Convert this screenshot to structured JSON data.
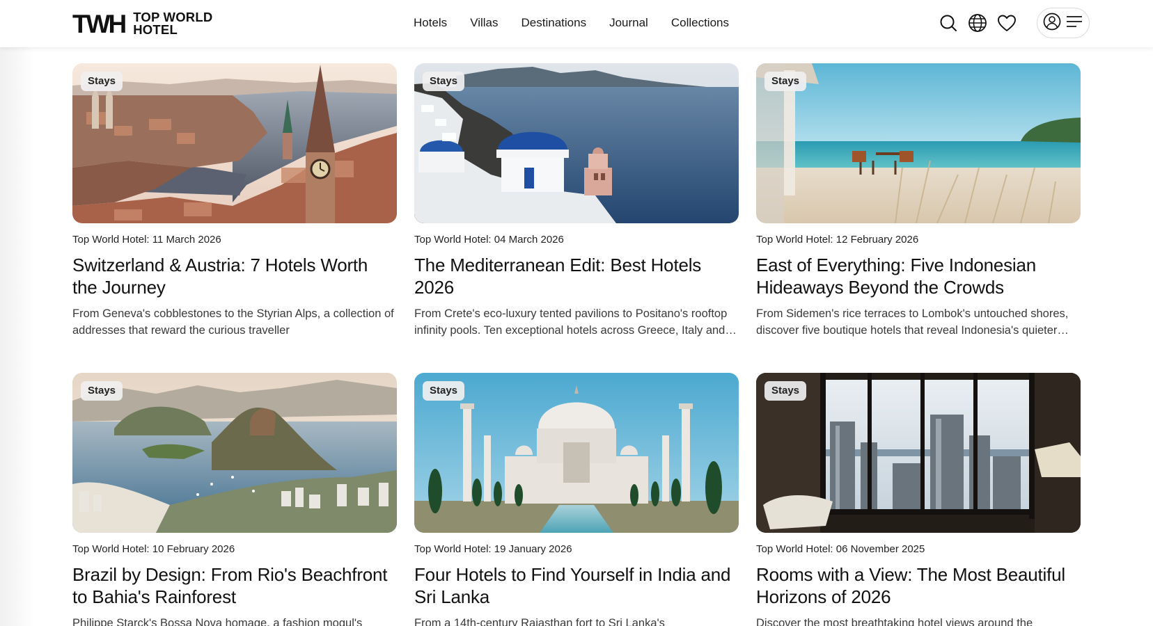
{
  "brand": {
    "mark": "TWH",
    "line1": "TOP WORLD",
    "line2": "HOTEL"
  },
  "nav": [
    "Hotels",
    "Villas",
    "Destinations",
    "Journal",
    "Collections"
  ],
  "header_icons": [
    "search-icon",
    "globe-icon",
    "heart-icon",
    "user-icon",
    "menu-icon"
  ],
  "cards": [
    {
      "tag": "Stays",
      "source": "Top World Hotel:",
      "date": "11 March 2026",
      "title": "Switzerland & Austria: 7 Hotels Worth the Journey",
      "excerpt": "From Geneva's cobblestones to the Styrian Alps, a collection of addresses that reward the curious traveller",
      "image": "zurich-old-town-clock-tower-lake"
    },
    {
      "tag": "Stays",
      "source": "Top World Hotel:",
      "date": "04 March 2026",
      "title": "The Mediterranean Edit: Best Hotels 2026",
      "excerpt": "From Crete's eco-luxury tented pavilions to Positano's rooftop infinity pools. Ten exceptional hotels across Greece, Italy and beyond",
      "image": "santorini-blue-domes-sea"
    },
    {
      "tag": "Stays",
      "source": "Top World Hotel:",
      "date": "12 February 2026",
      "title": "East of Everything: Five Indonesian Hideaways Beyond the Crowds",
      "excerpt": "From Sidemen's rice terraces to Lombok's untouched shores, discover five boutique hotels that reveal Indonesia's quieter side",
      "image": "beach-table-chairs-turquoise-sea"
    },
    {
      "tag": "Stays",
      "source": "Top World Hotel:",
      "date": "10 February 2026",
      "title": "Brazil by Design: From Rio's Beachfront to Bahia's Rainforest",
      "excerpt": "Philippe Starck's Bossa Nova homage, a fashion mogul's",
      "image": "rio-sugarloaf-bay"
    },
    {
      "tag": "Stays",
      "source": "Top World Hotel:",
      "date": "19 January 2026",
      "title": "Four Hotels to Find Yourself in India and Sri Lanka",
      "excerpt": "From a 14th-century Rajasthan fort to Sri Lanka's",
      "image": "taj-mahal-reflecting-pool"
    },
    {
      "tag": "Stays",
      "source": "Top World Hotel:",
      "date": "06 November 2025",
      "title": "Rooms with a View: The Most Beautiful Horizons of 2026",
      "excerpt": "Discover the most breathtaking hotel views around the",
      "image": "hotel-room-window-city-skyline"
    }
  ]
}
